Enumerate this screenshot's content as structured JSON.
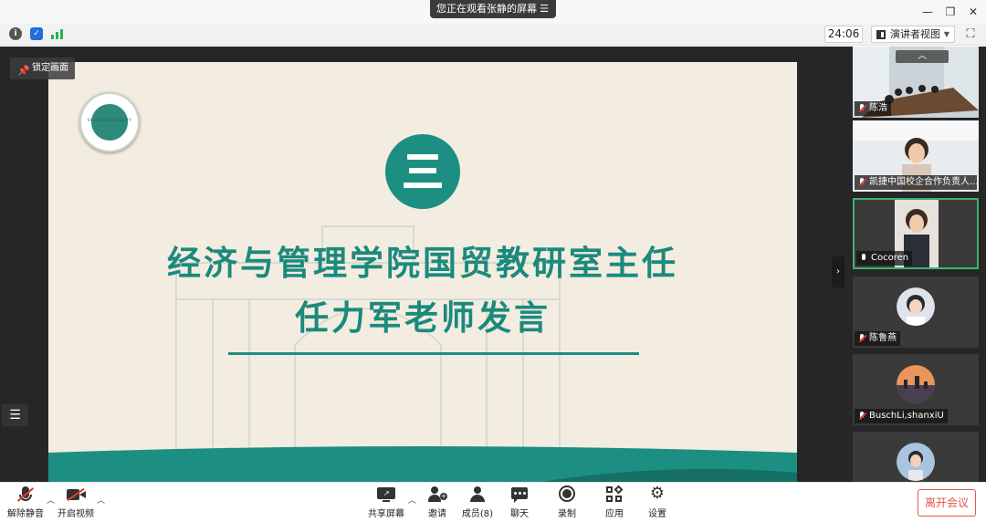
{
  "titlebar": {
    "viewing_text": "您正在观看张静的屏幕",
    "menu_glyph": "☰",
    "minimize": "—",
    "restore": "❐",
    "close": "✕"
  },
  "toolbar": {
    "info_icon": "i",
    "shield_icon": "✓",
    "timer": "24:06",
    "view_label": "演讲者视图",
    "view_caret": "▼",
    "fullscreen_glyph": "⛶"
  },
  "stage": {
    "pin_label": "锁定画面",
    "pin_glyph": "📌",
    "list_glyph": "☰",
    "collapse_glyph": "›"
  },
  "slide": {
    "logo_text": "SHANXI UNIVERSITY",
    "title_line1": "经济与管理学院国贸教研室主任",
    "title_line2": "任力军老师发言"
  },
  "participants": {
    "scroll_up_glyph": "︿",
    "tiles": [
      {
        "name": "陈浩",
        "muted": true
      },
      {
        "name": "凯捷中国校企合作负责人...",
        "muted": true
      },
      {
        "name": "Cocoren",
        "muted": false,
        "active": true
      },
      {
        "name": "陈鲁燕",
        "muted": true
      },
      {
        "name": "BuschLi,shanxiU",
        "muted": true
      },
      {
        "name": "",
        "muted": true
      }
    ]
  },
  "bottombar": {
    "unmute": "解除静音",
    "start_video": "开启视频",
    "share_screen": "共享屏幕",
    "invite": "邀请",
    "members": "成员(8)",
    "chat": "聊天",
    "record": "录制",
    "apps": "应用",
    "settings": "设置",
    "leave": "离开会议",
    "caret": "︿"
  },
  "colors": {
    "slide_teal": "#1b8a7d",
    "slide_bg": "#f3ece0",
    "leave_red": "#e2574c",
    "active_tile_border": "#3cb371"
  }
}
